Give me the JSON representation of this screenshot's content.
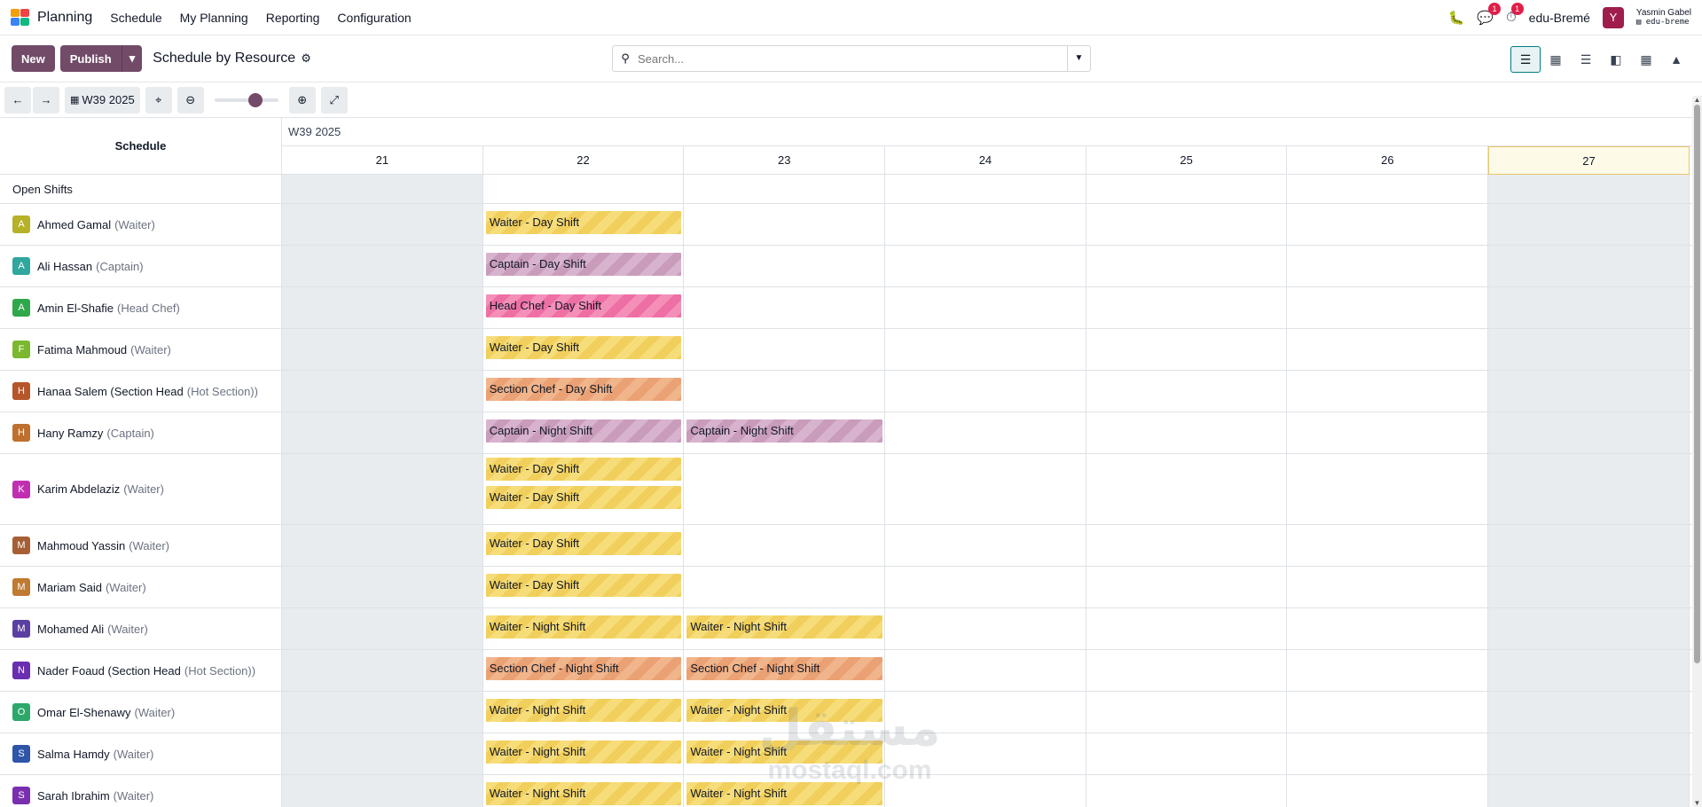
{
  "navbar": {
    "brand": "Planning",
    "menu": [
      "Schedule",
      "My Planning",
      "Reporting",
      "Configuration"
    ],
    "messages_badge": "1",
    "activity_badge": "1",
    "company": "edu-Bremé",
    "user_initial": "Y",
    "user_name": "Yasmin Gabel",
    "user_db": "edu-breme"
  },
  "control": {
    "new_label": "New",
    "publish_label": "Publish",
    "view_title": "Schedule by Resource",
    "search_placeholder": "Search..."
  },
  "toolbar": {
    "week_label": "W39 2025"
  },
  "gantt": {
    "column_header": "Schedule",
    "week_label": "W39 2025",
    "days": [
      "21",
      "22",
      "23",
      "24",
      "25",
      "26",
      "27"
    ],
    "today_index": 6,
    "weekend_indices": [
      0,
      6
    ]
  },
  "rows": [
    {
      "name": "Open Shifts",
      "role": "",
      "initial": "",
      "color": "",
      "shifts": []
    },
    {
      "name": "Ahmed Gamal",
      "role": "(Waiter)",
      "initial": "A",
      "color": "#b5b227",
      "shifts": [
        {
          "day": 1,
          "label": "Waiter - Day Shift",
          "style": "yellow"
        }
      ]
    },
    {
      "name": "Ali Hassan",
      "role": "(Captain)",
      "initial": "A",
      "color": "#2fa79c",
      "shifts": [
        {
          "day": 1,
          "label": "Captain - Day Shift",
          "style": "purple"
        }
      ]
    },
    {
      "name": "Amin El-Shafie",
      "role": "(Head Chef)",
      "initial": "A",
      "color": "#2ea84a",
      "shifts": [
        {
          "day": 1,
          "label": "Head Chef - Day Shift",
          "style": "pink"
        }
      ]
    },
    {
      "name": "Fatima Mahmoud",
      "role": "(Waiter)",
      "initial": "F",
      "color": "#7cb82f",
      "shifts": [
        {
          "day": 1,
          "label": "Waiter - Day Shift",
          "style": "yellow"
        }
      ]
    },
    {
      "name": "Hanaa Salem (Section Head",
      "role": "(Hot Section))",
      "initial": "H",
      "color": "#b5562b",
      "shifts": [
        {
          "day": 1,
          "label": "Section Chef - Day Shift",
          "style": "orange"
        }
      ]
    },
    {
      "name": "Hany Ramzy",
      "role": "(Captain)",
      "initial": "H",
      "color": "#c0702e",
      "shifts": [
        {
          "day": 1,
          "label": "Captain - Night Shift",
          "style": "purple"
        },
        {
          "day": 2,
          "label": "Captain - Night Shift",
          "style": "purple"
        }
      ]
    },
    {
      "name": "Karim Abdelaziz",
      "role": "(Waiter)",
      "initial": "K",
      "color": "#c02fb1",
      "shifts": [
        {
          "day": 1,
          "label": "Waiter - Day Shift",
          "style": "yellow"
        },
        {
          "day": 1,
          "label": "Waiter - Day Shift",
          "style": "yellow",
          "stack": 1
        }
      ]
    },
    {
      "name": "Mahmoud Yassin",
      "role": "(Waiter)",
      "initial": "M",
      "color": "#a65f35",
      "shifts": [
        {
          "day": 1,
          "label": "Waiter - Day Shift",
          "style": "yellow"
        }
      ]
    },
    {
      "name": "Mariam Said",
      "role": "(Waiter)",
      "initial": "M",
      "color": "#c07a32",
      "shifts": [
        {
          "day": 1,
          "label": "Waiter - Day Shift",
          "style": "yellow"
        }
      ]
    },
    {
      "name": "Mohamed Ali",
      "role": "(Waiter)",
      "initial": "M",
      "color": "#5b3fa3",
      "shifts": [
        {
          "day": 1,
          "label": "Waiter - Night Shift",
          "style": "yellow"
        },
        {
          "day": 2,
          "label": "Waiter - Night Shift",
          "style": "yellow"
        }
      ]
    },
    {
      "name": "Nader Foaud (Section Head",
      "role": "(Hot Section))",
      "initial": "N",
      "color": "#6a2fb0",
      "shifts": [
        {
          "day": 1,
          "label": "Section Chef - Night Shift",
          "style": "orange"
        },
        {
          "day": 2,
          "label": "Section Chef - Night Shift",
          "style": "orange"
        }
      ]
    },
    {
      "name": "Omar El-Shenawy",
      "role": "(Waiter)",
      "initial": "O",
      "color": "#2ea86a",
      "shifts": [
        {
          "day": 1,
          "label": "Waiter - Night Shift",
          "style": "yellow"
        },
        {
          "day": 2,
          "label": "Waiter - Night Shift",
          "style": "yellow"
        }
      ]
    },
    {
      "name": "Salma Hamdy",
      "role": "(Waiter)",
      "initial": "S",
      "color": "#2f55a8",
      "shifts": [
        {
          "day": 1,
          "label": "Waiter - Night Shift",
          "style": "yellow"
        },
        {
          "day": 2,
          "label": "Waiter - Night Shift",
          "style": "yellow"
        }
      ]
    },
    {
      "name": "Sarah Ibrahim",
      "role": "(Waiter)",
      "initial": "S",
      "color": "#7a2fb0",
      "shifts": [
        {
          "day": 1,
          "label": "Waiter - Night Shift",
          "style": "yellow"
        },
        {
          "day": 2,
          "label": "Waiter - Night Shift",
          "style": "yellow"
        }
      ]
    }
  ],
  "watermark": {
    "arabic": "مستقل",
    "latin": "mostaql.com"
  }
}
